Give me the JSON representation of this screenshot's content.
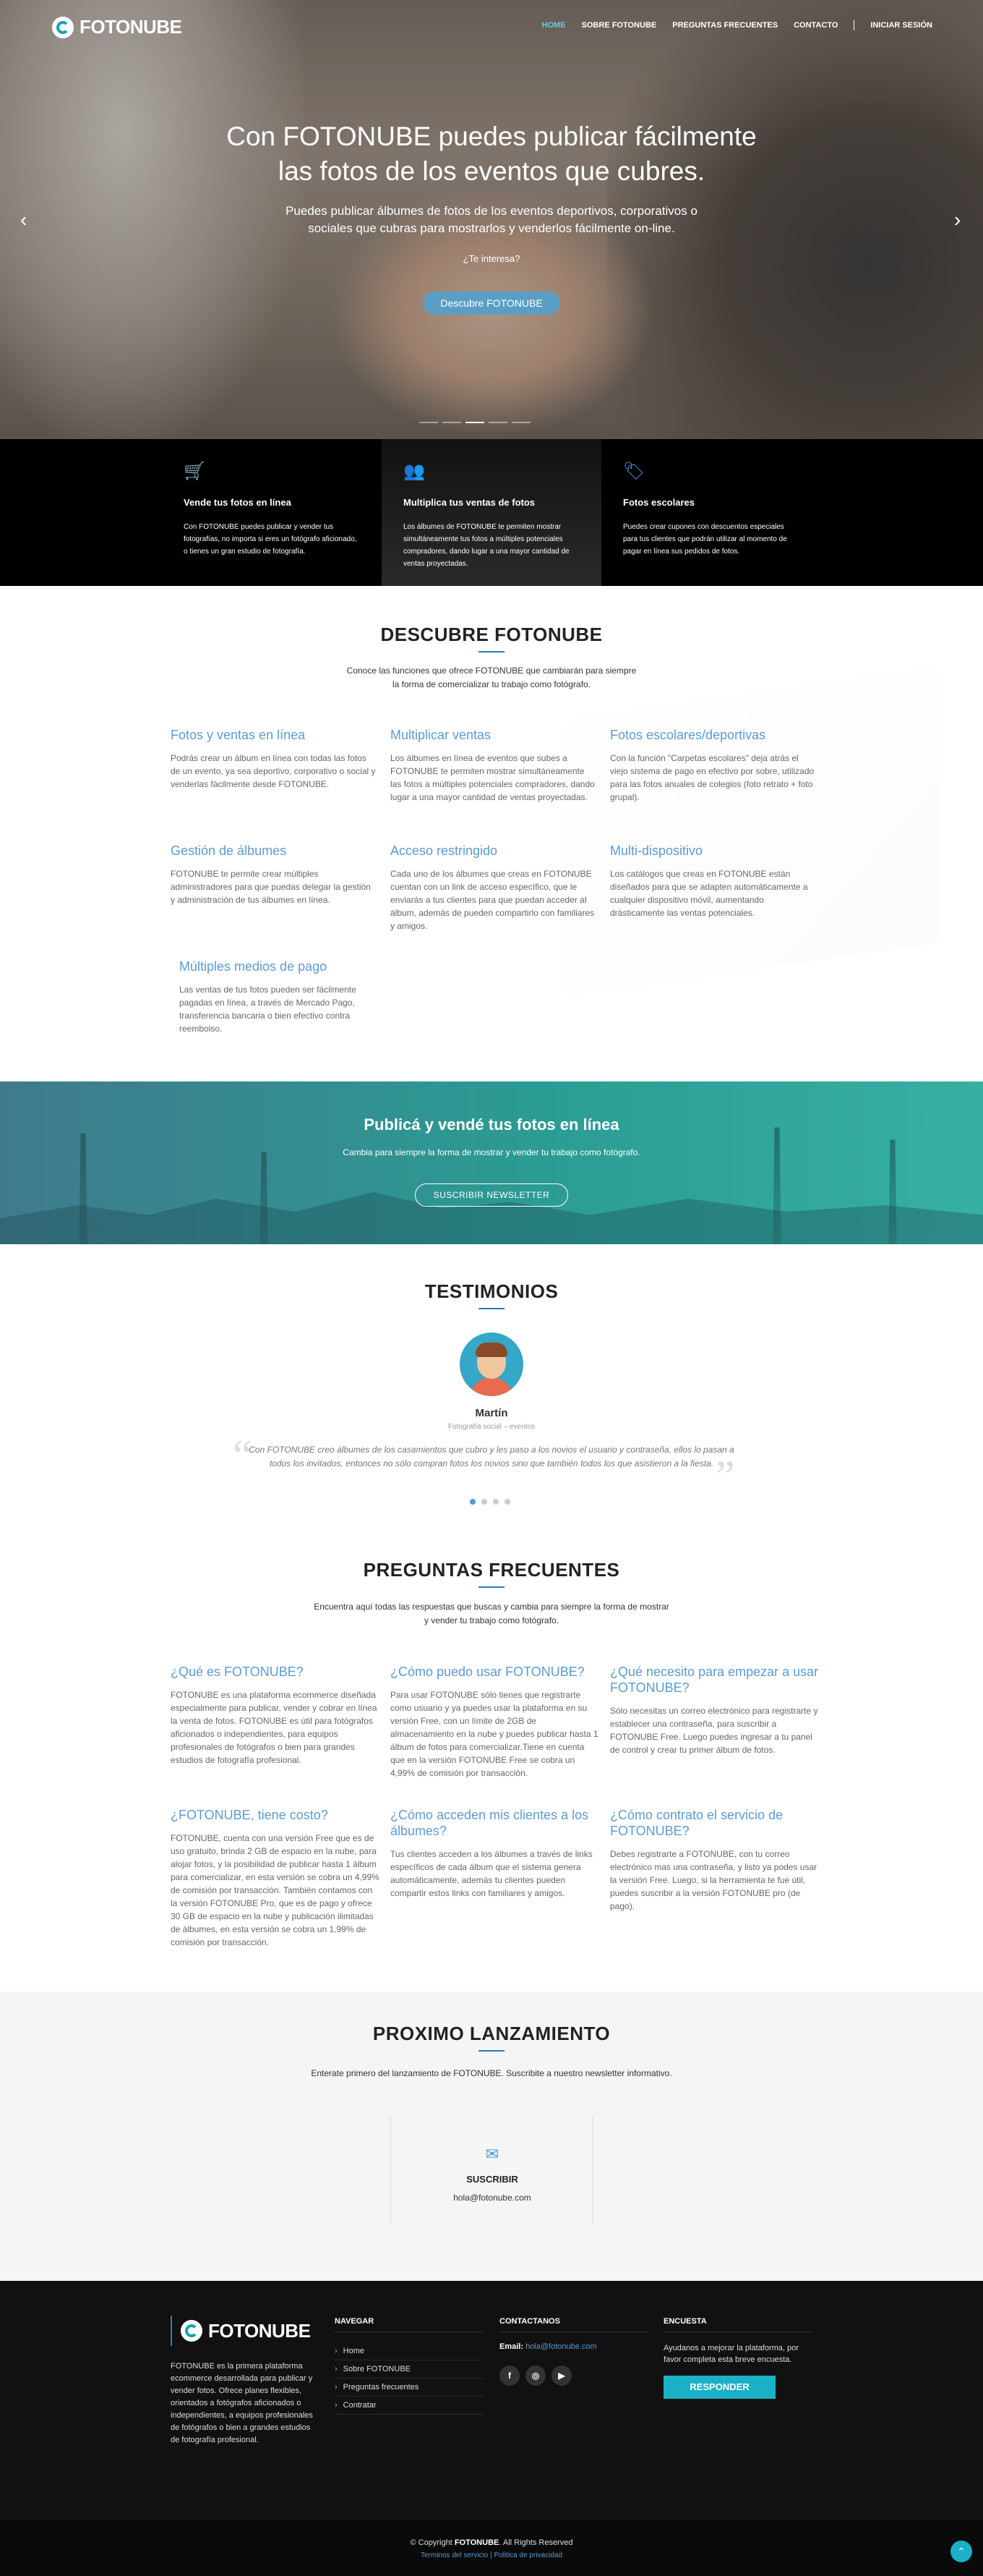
{
  "brand": {
    "name": "FOTONUBE"
  },
  "nav": {
    "items": [
      "HOME",
      "SOBRE FOTONUBE",
      "PREGUNTAS FRECUENTES",
      "CONTACTO"
    ],
    "login": "INICIAR SESIÓN"
  },
  "hero": {
    "title_line1": "Con FOTONUBE puedes publicar fácilmente",
    "title_line2": "las fotos de los eventos que cubres.",
    "sub_line1": "Puedes publicar álbumes de fotos de los eventos deportivos, corporativos o",
    "sub_line2": "sociales que cubras para mostrarlos y venderlos fácilmente on-line.",
    "question": "¿Te interesa?",
    "button": "Descubre FOTONUBE",
    "prev": "‹",
    "next": "›"
  },
  "features": [
    {
      "icon": "cart-icon",
      "glyph": "🛒",
      "title": "Vende tus fotos en línea",
      "text": "Con FOTONUBE puedes publicar y vender tus fotografías, no importa si eres un fotógrafo aficionado, o tienes un gran estudio de fotografía."
    },
    {
      "icon": "users-icon",
      "glyph": "👥",
      "title": "Multiplica tus ventas de fotos",
      "text": "Los álbumes de FOTONUBE te permiten mostrar simultáneamente tus fotos a múltiples potenciales compradores, dando lugar a una mayor cantidad de ventas proyectadas."
    },
    {
      "icon": "tag-icon",
      "glyph": "🏷",
      "title": "Fotos escolares",
      "text": "Puedes crear cupones con descuentos especiales para tus clientes que podrán utilizar al momento de pagar en línea sus pedidos de fotos."
    }
  ],
  "descubre": {
    "title": "DESCUBRE FOTONUBE",
    "intro_line1": "Conoce las funciones que ofrece FOTONUBE que cambiarán para siempre",
    "intro_line2": "la forma de comercializar tu trabajo como fotógrafo.",
    "items": [
      {
        "title": "Fotos y ventas en línea",
        "text": "Podrás crear un álbum en línea con todas las fotos de un evento, ya sea deportivo, corporativo o social y venderlas fácilmente desde FOTONUBE."
      },
      {
        "title": "Multiplicar ventas",
        "text": "Los álbumes en línea de eventos que subes a FOTONUBE te permiten mostrar simultáneamente las fotos a múltiples potenciales compradores, dando lugar a una mayor cantidad de ventas proyectadas."
      },
      {
        "title": "Fotos escolares/deportivas",
        "text": "Con la función \"Carpetas escolares\" deja atrás el viejo sistema de pago en efectivo por sobre, utilizado para las fotos anuales de colegios (foto retrato + foto grupal)."
      },
      {
        "title": "Gestión de álbumes",
        "text": "FOTONUBE te permite crear múltiples administradores para que puedas delegar la gestión y administración de tus álbumes en línea."
      },
      {
        "title": "Acceso restringido",
        "text": "Cada uno de los álbumes que creas en FOTONUBE cuentan con un link de acceso específico, que le enviarás a tus clientes para que puedan acceder al álbum, además de pueden compartirlo con familiares y amigos."
      },
      {
        "title": "Multi-dispositivo",
        "text": "Los catálogos que creas en FOTONUBE están diseñados para que se adapten automáticamente a cualquier dispositivo móvil, aumentando drásticamente las ventas potenciales."
      },
      {
        "title": "Múltiples medios de pago",
        "text": "Las ventas de tus fotos pueden ser fácilmente pagadas en línea, a través de Mercado Pago, transferencia bancaria o bien efectivo contra reembolso."
      }
    ]
  },
  "cta": {
    "title": "Publicá y vendé tus fotos en línea",
    "text": "Cambia para siempre la forma de mostrar y vender tu trabajo como fotógrafo.",
    "button": "SUSCRIBIR NEWSLETTER"
  },
  "testimonios": {
    "title": "TESTIMONIOS",
    "name": "Martín",
    "role": "Fotografía social – eventos",
    "quote": "Con FOTONUBE creo álbumes de los casamientos que cubro y les paso a los novios el usuario y contraseña, ellos lo pasan a todos los invitados, entonces no sólo compran fotos los novios sino que también todos los que asistieron a la fiesta.",
    "open_mark": "“",
    "close_mark": "”"
  },
  "faq": {
    "title": "PREGUNTAS FRECUENTES",
    "intro_line1": "Encuentra aquí todas las respuestas que buscas y cambia para siempre la forma de mostrar",
    "intro_line2": "y vender tu trabajo como fotógrafo.",
    "items": [
      {
        "q": "¿Qué es FOTONUBE?",
        "a": "FOTONUBE es una plataforma ecommerce diseñada especialmente para publicar, vender y cobrar en línea la venta de fotos. FOTONUBE es útil para fotógrafos aficionados o independientes, para equipos profesionales de fotógrafos o bien para grandes estudios de fotografía profesional."
      },
      {
        "q": "¿Cómo puedo usar FOTONUBE?",
        "a": "Para usar FOTONUBE sólo tienes que registrarte como usuario y ya puedes usar la plataforma en su versión Free, con un límite de 2GB de almacenamiento en la nube y puedes publicar hasta 1 álbum de fotos para comercializar.Tiene en cuenta que en la versión FOTONUBE Free se cobra un 4,99% de comisión por transacción."
      },
      {
        "q": "¿Qué necesito para empezar a usar FOTONUBE?",
        "a": "Sólo necesitas un correo electrónico para registrarte y establecer una contraseña, para suscribir a FOTONUBE Free. Luego puedes ingresar a tu panel de control y crear tu primer álbum de fotos."
      },
      {
        "q": "¿FOTONUBE, tiene costo?",
        "a": "FOTONUBE, cuenta con una versión Free que es de uso gratuito, brinda 2 GB de espacio en la nube, para alojar fotos, y la posibilidad de publicar hasta 1 álbum para comercializar, en esta versión se cobra un 4,99% de comisión por transacción. También contamos con la versión FOTONUBE Pro, que es de pago y ofrece 30 GB de espacio en la nube y publicación ilimitadas de álbumes, en esta versión se cobra un 1,99% de comisión por transacción."
      },
      {
        "q": "¿Cómo acceden mis clientes a los álbumes?",
        "a": "Tus clientes acceden a los álbumes a través de links específicos de cada álbum que el sistema genera automáticamente, además tu clientes pueden compartir estos links con familiares y amigos."
      },
      {
        "q": "¿Cómo contrato el servicio de FOTONUBE?",
        "a": "Debes registrarte a FOTONUBE, con tu correo electrónico mas una contraseña, y listo ya podes usar la versión Free. Luego, si la herramienta te fue útil, puedes suscribir a la versión FOTONUBE pro (de pago)."
      }
    ]
  },
  "proximo": {
    "title": "PROXIMO LANZAMIENTO",
    "intro": "Enterate primero del lanzamiento de FOTONUBE. Suscribite a nuestro newsletter informativo.",
    "label": "SUSCRIBIR",
    "email": "hola@fotonube.com",
    "icon": "✉"
  },
  "footer": {
    "desc": "FOTONUBE es la primera plataforma ecommerce desarrollada para publicar y vender fotos. Ofrece planes flexibles, orientados a fotógrafos aficionados o independientes, a equipos profesionales de fotógrafos o bien a grandes estudios de fotografía profesional.",
    "nav_title": "NAVEGAR",
    "nav_items": [
      "Home",
      "Sobre FOTONUBE",
      "Preguntas frecuentes",
      "Contratar"
    ],
    "contact_title": "CONTACTANOS",
    "email_label": "Email:",
    "email": "hola@fotonube.com",
    "social": [
      "f",
      "◎",
      "▶"
    ],
    "survey_title": "ENCUESTA",
    "survey_text": "Ayudanos a mejorar la plataforma, por favor completa esta breve encuesta.",
    "survey_button": "RESPONDER",
    "copy_pre": "© Copyright",
    "copy_brand": "FOTONUBE",
    "copy_post": ". All Rights Reserved",
    "legal": "Terminos del servicio | Politica de privacidad",
    "top": "⌃"
  },
  "colors": {
    "accent": "#5b9bd1",
    "teal": "#1ab0c8",
    "dark": "#111111"
  }
}
